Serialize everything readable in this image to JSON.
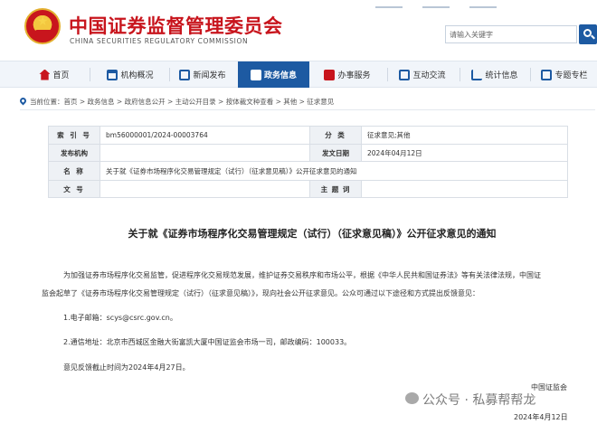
{
  "header": {
    "title_cn": "中国证券监督管理委员会",
    "title_en": "CHINA SECURITIES REGULATORY COMMISSION",
    "search_placeholder": "请输入关键字"
  },
  "nav": {
    "items": [
      {
        "label": "首页",
        "icon": "home-icon"
      },
      {
        "label": "机构概况",
        "icon": "building-icon"
      },
      {
        "label": "新闻发布",
        "icon": "news-icon"
      },
      {
        "label": "政务信息",
        "icon": "gov-info-icon"
      },
      {
        "label": "办事服务",
        "icon": "service-icon"
      },
      {
        "label": "互动交流",
        "icon": "chat-icon"
      },
      {
        "label": "统计信息",
        "icon": "stats-icon"
      },
      {
        "label": "专题专栏",
        "icon": "topic-icon"
      }
    ],
    "active_index": 3,
    "accent_color": "#1d5aa2",
    "brand_color": "#c8151d"
  },
  "breadcrumb": "当前位置：首页 > 政务信息 > 政府信息公开 > 主动公开目录 > 按体裁文种查看 > 其他 > 征求意见",
  "meta": {
    "index_label": "索 引 号",
    "index_value": "bm56000001/2024-00003764",
    "category_label": "分 类",
    "category_value": "征求意见;其他",
    "publisher_label": "发布机构",
    "publisher_value": "",
    "date_label": "发文日期",
    "date_value": "2024年04月12日",
    "name_label": "名 称",
    "name_value": "关于就《证券市场程序化交易管理规定（试行）（征求意见稿）》公开征求意见的通知",
    "docno_label": "文 号",
    "docno_value": "",
    "subject_label": "主 题 词",
    "subject_value": ""
  },
  "article": {
    "title": "关于就《证券市场程序化交易管理规定（试行）（征求意见稿）》公开征求意见的通知",
    "p1_line1": "为加强证券市场程序化交易监管，促进程序化交易规范发展，维护证券交易秩序和市场公平，根据《中华人民共和国证券法》等有关法律法规，中国证",
    "p1_line2": "监会起草了《证券市场程序化交易管理规定（试行）（征求意见稿）》，现向社会公开征求意见。公众可通过以下途径和方式提出反馈意见：",
    "item1": "1.电子邮箱：scys@csrc.gov.cn。",
    "item2": "2.通信地址：北京市西城区金融大街富凯大厦中国证监会市场一司，邮政编码：100033。",
    "deadline": "意见反馈截止时间为2024年4月27日。",
    "signature": "中国证监会",
    "sign_date": "2024年4月12日"
  },
  "watermark": "公众号 · 私募帮帮龙"
}
